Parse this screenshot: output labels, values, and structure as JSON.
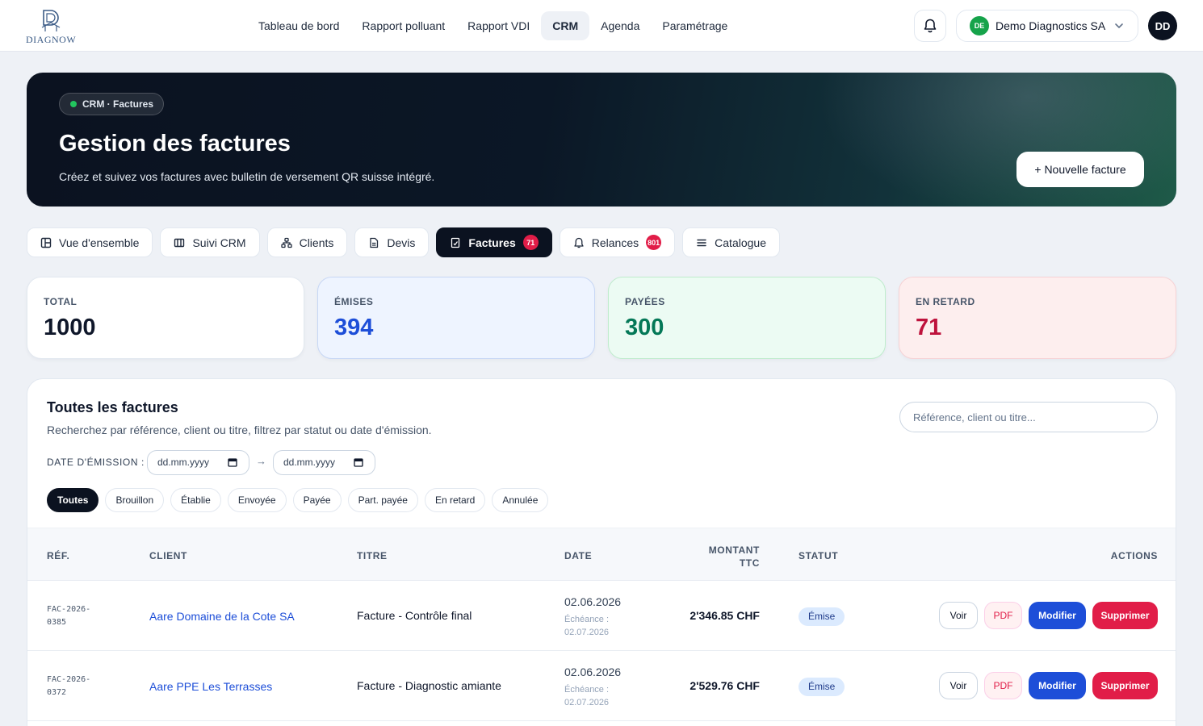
{
  "brand": {
    "logo_text": "DIAGNOW"
  },
  "nav": {
    "links": [
      "Tableau de bord",
      "Rapport polluant",
      "Rapport VDI",
      "CRM",
      "Agenda",
      "Paramétrage"
    ],
    "active": "CRM"
  },
  "header": {
    "org_initials": "DE",
    "org_name": "Demo Diagnostics SA",
    "user_initials": "DD",
    "icons": [
      "bell-icon",
      "chevron-down-icon"
    ]
  },
  "hero": {
    "pill": "CRM · Factures",
    "title": "Gestion des factures",
    "subtitle": "Créez et suivez vos factures avec bulletin de versement QR suisse intégré.",
    "new_button": "+ Nouvelle facture"
  },
  "tabs": [
    {
      "label": "Vue d'ensemble",
      "icon": "layout-icon"
    },
    {
      "label": "Suivi CRM",
      "icon": "kanban-icon"
    },
    {
      "label": "Clients",
      "icon": "network-icon"
    },
    {
      "label": "Devis",
      "icon": "document-icon"
    },
    {
      "label": "Factures",
      "icon": "receipt-icon",
      "count": "71",
      "active": true
    },
    {
      "label": "Relances",
      "icon": "bell-icon",
      "count": "801"
    },
    {
      "label": "Catalogue",
      "icon": "list-icon"
    }
  ],
  "stats": {
    "total": {
      "label": "TOTAL",
      "value": "1000"
    },
    "emises": {
      "label": "ÉMISES",
      "value": "394"
    },
    "payees": {
      "label": "PAYÉES",
      "value": "300"
    },
    "retard": {
      "label": "EN RETARD",
      "value": "71"
    }
  },
  "invoices": {
    "title": "Toutes les factures",
    "subtitle": "Recherchez par référence, client ou titre, filtrez par statut ou date d'émission.",
    "search_placeholder": "Référence, client ou titre...",
    "date_label": "DATE D'ÉMISSION :",
    "date_from": "dd.mm.yyyy",
    "date_to": "dd.mm.yyyy",
    "date_arrow": "→",
    "filters": [
      "Toutes",
      "Brouillon",
      "Établie",
      "Envoyée",
      "Payée",
      "Part. payée",
      "En retard",
      "Annulée"
    ],
    "active_filter": "Toutes",
    "columns": {
      "ref": "RÉF.",
      "client": "CLIENT",
      "titre": "TITRE",
      "date": "DATE",
      "montant": "MONTANT TTC",
      "statut": "STATUT",
      "actions": "ACTIONS"
    },
    "action_labels": {
      "view": "Voir",
      "pdf": "PDF",
      "edit": "Modifier",
      "delete": "Supprimer"
    },
    "rows": [
      {
        "ref": "FAC-2026-0385",
        "client": "Aare Domaine de la Cote SA",
        "titre": "Facture - Contrôle final",
        "date": "02.06.2026",
        "due": "Échéance : 02.07.2026",
        "amount": "2'346.85 CHF",
        "status": "Émise"
      },
      {
        "ref": "FAC-2026-0372",
        "client": "Aare PPE Les Terrasses",
        "titre": "Facture - Diagnostic amiante",
        "date": "02.06.2026",
        "due": "Échéance : 02.07.2026",
        "amount": "2'529.76 CHF",
        "status": "Émise"
      }
    ]
  },
  "colors": {
    "accent_dark": "#0b1220",
    "primary_blue": "#1d4ed8",
    "danger": "#e11d48",
    "success": "#16a34a"
  }
}
